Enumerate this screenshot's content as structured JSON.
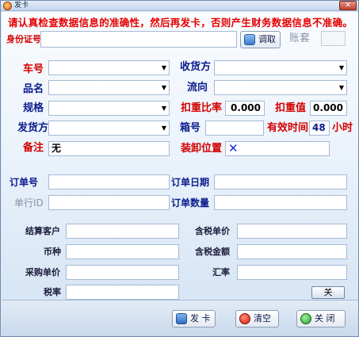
{
  "window": {
    "title": "发卡",
    "close_glyph": "✕"
  },
  "warning": "请认真检查数据信息的准确性，然后再发卡，否则产生财务数据信息不准确。",
  "id_card": {
    "label": "身份证号",
    "value": "",
    "query_button": "调取",
    "account_set_label": "账套",
    "account_set_value": ""
  },
  "form": {
    "truck_no": {
      "label": "车号",
      "value": ""
    },
    "receiver": {
      "label": "收货方",
      "value": ""
    },
    "product": {
      "label": "品名",
      "value": ""
    },
    "flow": {
      "label": "流向",
      "value": ""
    },
    "spec": {
      "label": "规格",
      "value": ""
    },
    "deduct_ratio": {
      "label": "扣重比率",
      "value": "0.000"
    },
    "deduct_value": {
      "label": "扣重值",
      "value": "0.000"
    },
    "shipper": {
      "label": "发货方",
      "value": ""
    },
    "box_no": {
      "label": "箱号",
      "value": ""
    },
    "valid_time": {
      "label": "有效时间",
      "value": "48",
      "unit": "小时"
    },
    "remark": {
      "label": "备注",
      "value": "无"
    },
    "load_position": {
      "label": "装卸位置",
      "value": "✕"
    }
  },
  "order": {
    "order_no": {
      "label": "订单号",
      "value": ""
    },
    "order_date": {
      "label": "订单日期",
      "value": ""
    },
    "unit_id": {
      "label": "单行ID",
      "value": ""
    },
    "order_qty": {
      "label": "订单数量",
      "value": ""
    }
  },
  "settlement": {
    "customer": {
      "label": "结算客户",
      "value": ""
    },
    "tax_price": {
      "label": "含税单价",
      "value": ""
    },
    "currency": {
      "label": "币种",
      "value": ""
    },
    "tax_amount": {
      "label": "含税金额",
      "value": ""
    },
    "purchase_price": {
      "label": "采购单价",
      "value": ""
    },
    "exchange_rate": {
      "label": "汇率",
      "value": ""
    },
    "tax_rate": {
      "label": "税率",
      "value": ""
    },
    "toggle_button": "关"
  },
  "actions": {
    "issue_card": "发 卡",
    "clear": "清空",
    "close": "关 闭"
  },
  "colors": {
    "warning": "#e60000",
    "label_red": "#d40000",
    "label_navy": "#0b1b8c"
  },
  "icons": {
    "app": "app-icon",
    "query": "query-icon",
    "issue": "card-icon",
    "clear": "clear-icon",
    "close": "close-icon"
  }
}
